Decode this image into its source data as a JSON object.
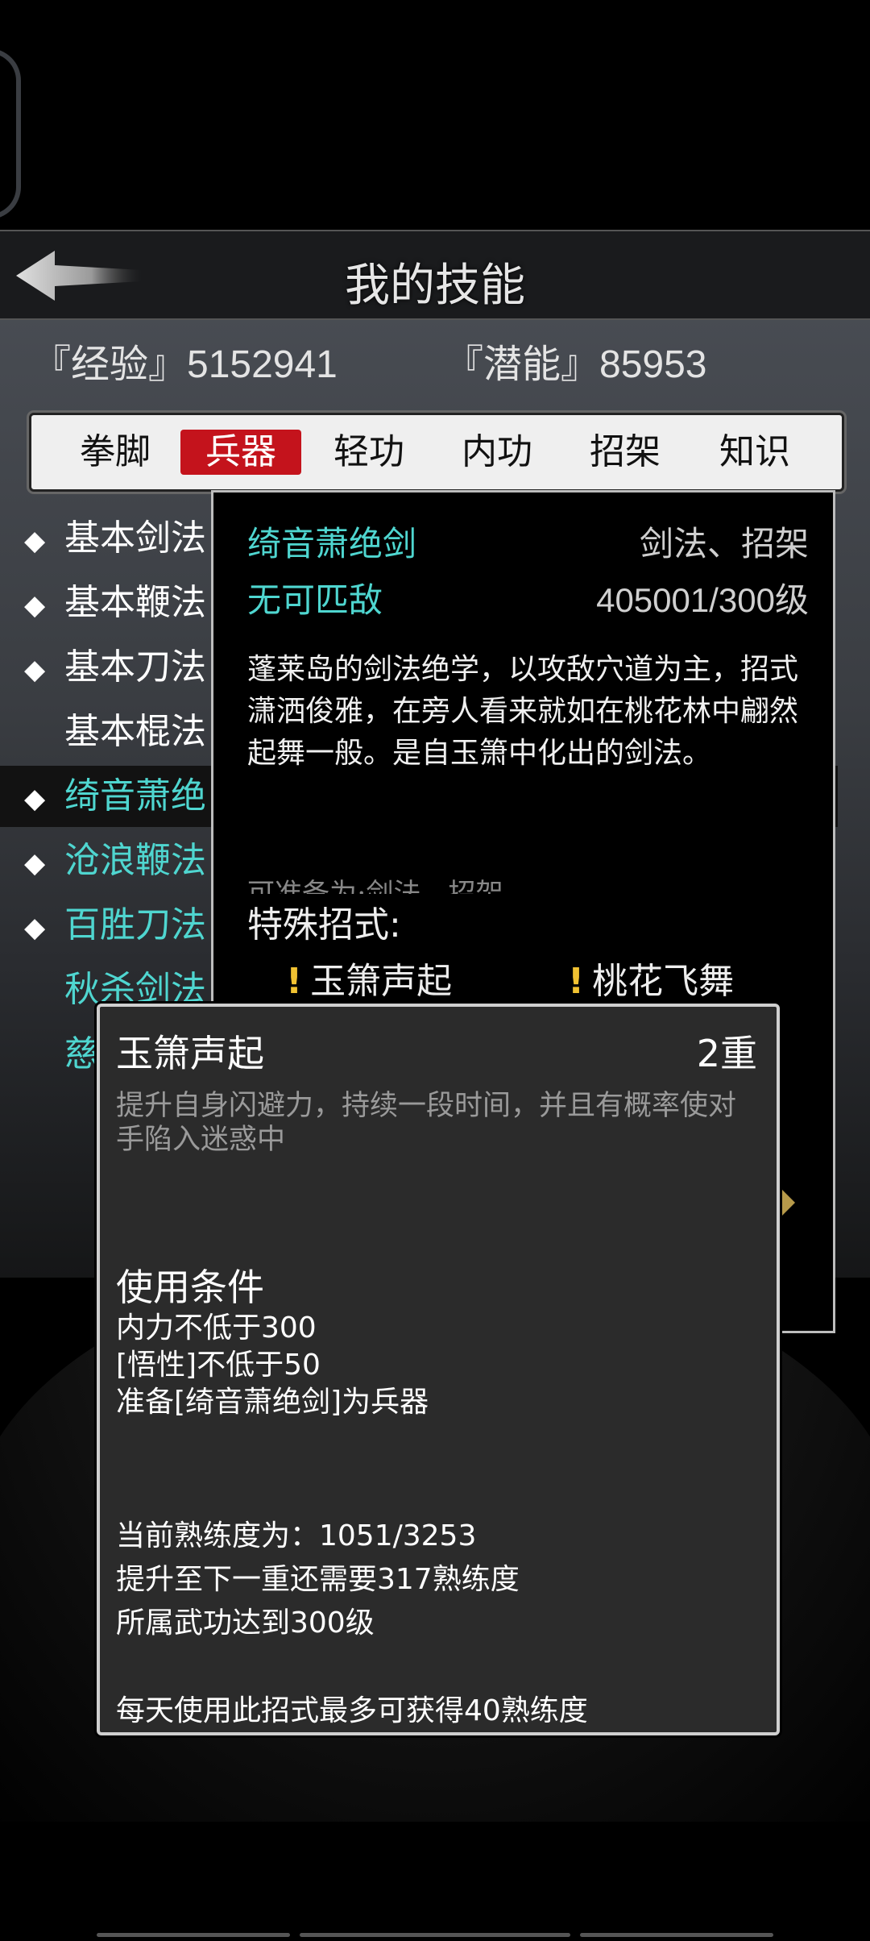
{
  "header": {
    "title": "我的技能"
  },
  "stats": {
    "exp": "『经验』5152941",
    "potential": "『潜能』85953"
  },
  "tabs": [
    {
      "label": "拳脚",
      "active": false
    },
    {
      "label": "兵器",
      "active": true
    },
    {
      "label": "轻功",
      "active": false
    },
    {
      "label": "内功",
      "active": false
    },
    {
      "label": "招架",
      "active": false
    },
    {
      "label": "知识",
      "active": false
    }
  ],
  "skills": [
    {
      "name": "基本剑法",
      "marker": true,
      "color": "#ffffff"
    },
    {
      "name": "基本鞭法",
      "marker": true,
      "color": "#ffffff"
    },
    {
      "name": "基本刀法",
      "marker": true,
      "color": "#ffffff"
    },
    {
      "name": "基本棍法",
      "marker": false,
      "color": "#ffffff"
    },
    {
      "name": "绮音萧绝",
      "marker": true,
      "color": "#4fd6d0"
    },
    {
      "name": "沧浪鞭法",
      "marker": true,
      "color": "#4fd6d0"
    },
    {
      "name": "百胜刀法",
      "marker": true,
      "color": "#4fd6d0"
    },
    {
      "name": "秋杀剑法",
      "marker": false,
      "color": "#4fd6d0"
    },
    {
      "name": "慈",
      "marker": false,
      "color": "#4fd6d0"
    }
  ],
  "detail": {
    "name": "绮音萧绝剑",
    "type": "剑法、招架",
    "rank": "无可匹敌",
    "level": "405001/300级",
    "description": "蓬莱岛的剑法绝学，以攻敌穴道为主，招式潇洒俊雅，在旁人看来就如在桃花林中翩然起舞一般。是自玉箫中化出的剑法。",
    "equip": "可准备为:剑法、招架",
    "special_title": "特殊招式:",
    "moves": [
      "玉箫声起",
      "桃花飞舞"
    ],
    "move_marker": "!"
  },
  "popup": {
    "name": "玉箫声起",
    "tier": "2重",
    "description": "提升自身闪避力，持续一段时间，并且有概率使对手陷入迷惑中",
    "conditions_title": "使用条件",
    "conditions": [
      "内力不低于300",
      "[悟性]不低于50",
      "准备[绮音萧绝剑]为兵器"
    ],
    "progress": [
      "当前熟练度为：1051/3253",
      "提升至下一重还需要317熟练度",
      "所属武功达到300级"
    ],
    "daily": "每天使用此招式最多可获得40熟练度"
  },
  "colors": {
    "accent_red": "#c4131c",
    "cyan": "#4fd6d0",
    "marker_yellow": "#f1c232"
  }
}
